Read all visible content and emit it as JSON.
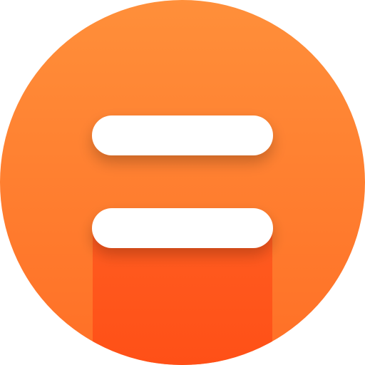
{
  "icon": {
    "name": "equals-sign-app-icon",
    "colors": {
      "circle_top": "#FF8F3A",
      "circle_bottom": "#FF6F26",
      "shadow_column_top": "#FF5A1F",
      "shadow_column_bottom": "#FF4A14",
      "bar": "#FFFFFF"
    }
  }
}
